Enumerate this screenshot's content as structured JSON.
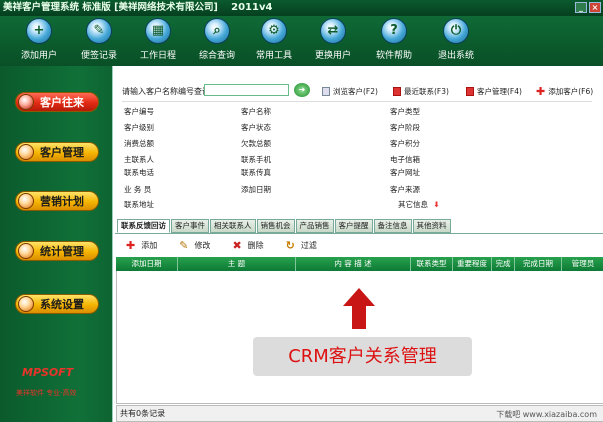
{
  "window": {
    "title": "美祥客户管理系统 标准版 [美祥网络技术有限公司]",
    "version": "2011v4"
  },
  "toolbar": {
    "items": [
      {
        "label": "添加用户",
        "icon": "add-user-icon"
      },
      {
        "label": "便签记录",
        "icon": "notes-icon"
      },
      {
        "label": "工作日程",
        "icon": "calendar-icon"
      },
      {
        "label": "综合查询",
        "icon": "search-icon"
      },
      {
        "label": "常用工具",
        "icon": "tools-icon"
      },
      {
        "label": "更换用户",
        "icon": "switch-user-icon"
      },
      {
        "label": "软件帮助",
        "icon": "help-icon"
      },
      {
        "label": "退出系统",
        "icon": "exit-icon"
      }
    ]
  },
  "sidebar": {
    "items": [
      {
        "label": "客户往来"
      },
      {
        "label": "客户管理"
      },
      {
        "label": "营销计划"
      },
      {
        "label": "统计管理"
      },
      {
        "label": "系统设置"
      }
    ],
    "logo": "MPSOFT",
    "logo_sub": "美祥软件 专业·高效"
  },
  "search": {
    "label": "请输入客户名称编号查询：",
    "value": "",
    "actions": [
      {
        "label": "浏览客户(F2)"
      },
      {
        "label": "最近联系(F3)"
      },
      {
        "label": "客户管理(F4)"
      },
      {
        "label": "添加客户(F6)"
      }
    ]
  },
  "info": {
    "col1": [
      "客户编号",
      "客户级别",
      "消费总额",
      "主联系人",
      "联系电话",
      "业 务 员",
      "联系地址"
    ],
    "col2": [
      "客户名称",
      "客户状态",
      "欠款总额",
      "联系手机",
      "联系传真",
      "添加日期"
    ],
    "col3": [
      "客户类型",
      "客户阶段",
      "客户积分",
      "电子信箱",
      "客户网址",
      "客户来源",
      "其它信息"
    ]
  },
  "tabs": [
    "联系反馈回访",
    "客户事件",
    "相关联系人",
    "销售机会",
    "产品销售",
    "客户提醒",
    "备注信息",
    "其他资料"
  ],
  "subbar": {
    "add": "添加",
    "edit": "修改",
    "delete": "删除",
    "filter": "过滤"
  },
  "grid": {
    "columns": [
      "添加日期",
      "主    题",
      "内 容 描 述",
      "联系类型",
      "重要程度",
      "完成",
      "完成日期",
      "管理员"
    ]
  },
  "status": "共有0条记录",
  "callout": "CRM客户关系管理",
  "watermark": "下载吧 www.xiazaiba.com"
}
